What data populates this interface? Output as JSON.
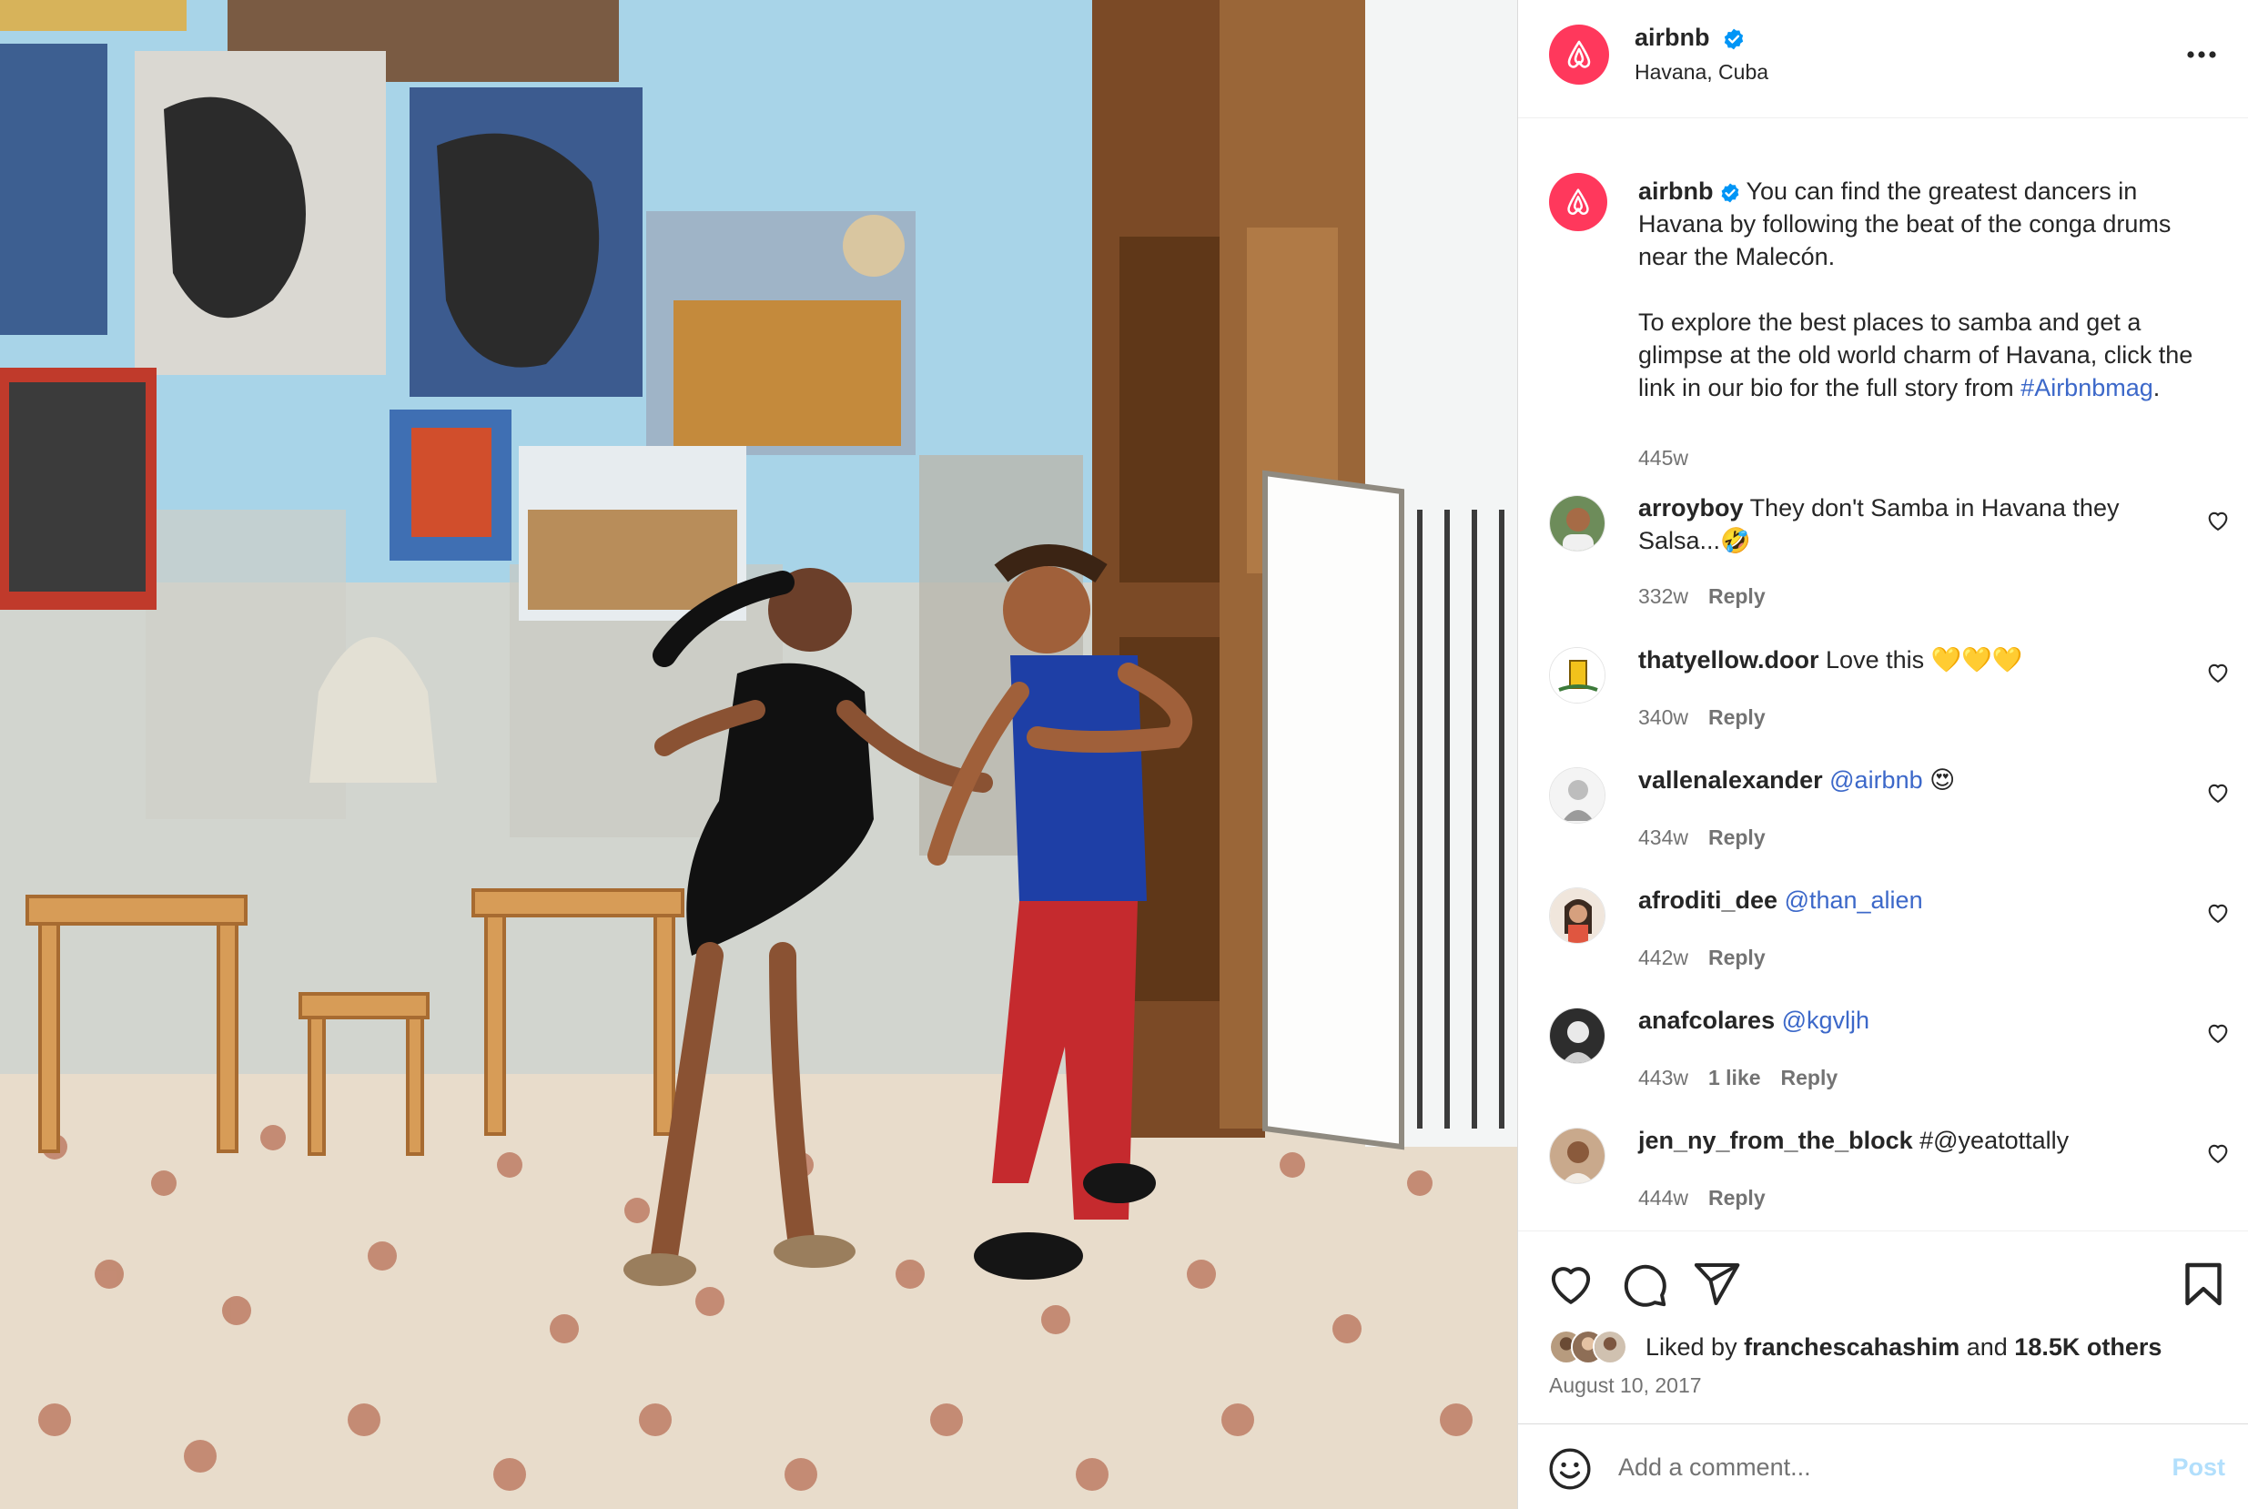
{
  "post": {
    "username": "airbnb",
    "location": "Havana, Cuba",
    "brand_color": "#ff385c",
    "verified_color": "#0095f6"
  },
  "caption": {
    "username": "airbnb",
    "paragraph1": "You can find the greatest dancers in Havana by following the beat of the conga drums near the Malecón.",
    "paragraph2_before": "To explore the best places to samba and get a glimpse at the old world charm of Havana, click the link in our bio for the full story from ",
    "hashtag": "#Airbnbmag",
    "paragraph2_after": ".",
    "time": "445w"
  },
  "comments": [
    {
      "username": "arroyboy",
      "text": "They don't Samba in Havana they Salsa...🤣",
      "mention": "",
      "time": "332w",
      "likes": "",
      "reply": "Reply"
    },
    {
      "username": "thatyellow.door",
      "text": "Love this 💛💛💛",
      "mention": "",
      "time": "340w",
      "likes": "",
      "reply": "Reply"
    },
    {
      "username": "vallenalexander",
      "text": " 😍",
      "mention": "@airbnb",
      "time": "434w",
      "likes": "",
      "reply": "Reply"
    },
    {
      "username": "afroditi_dee",
      "text": "",
      "mention": "@than_alien",
      "time": "442w",
      "likes": "",
      "reply": "Reply"
    },
    {
      "username": "anafcolares",
      "text": "",
      "mention": "@kgvljh",
      "time": "443w",
      "likes": "1 like",
      "reply": "Reply"
    },
    {
      "username": "jen_ny_from_the_block",
      "text": "#@yeatottally",
      "mention": "",
      "time": "444w",
      "likes": "",
      "reply": "Reply"
    }
  ],
  "likes": {
    "prefix": "Liked by",
    "liker": "franchescahashim",
    "connector": "and",
    "others": "18.5K others"
  },
  "date": "August 10, 2017",
  "add_comment": {
    "placeholder": "Add a comment...",
    "post_label": "Post"
  },
  "icons": {
    "more": "more-horizontal-icon",
    "like": "heart-icon",
    "comment": "speech-bubble-icon",
    "share": "paper-plane-icon",
    "save": "bookmark-icon",
    "emoji": "smiley-icon"
  }
}
